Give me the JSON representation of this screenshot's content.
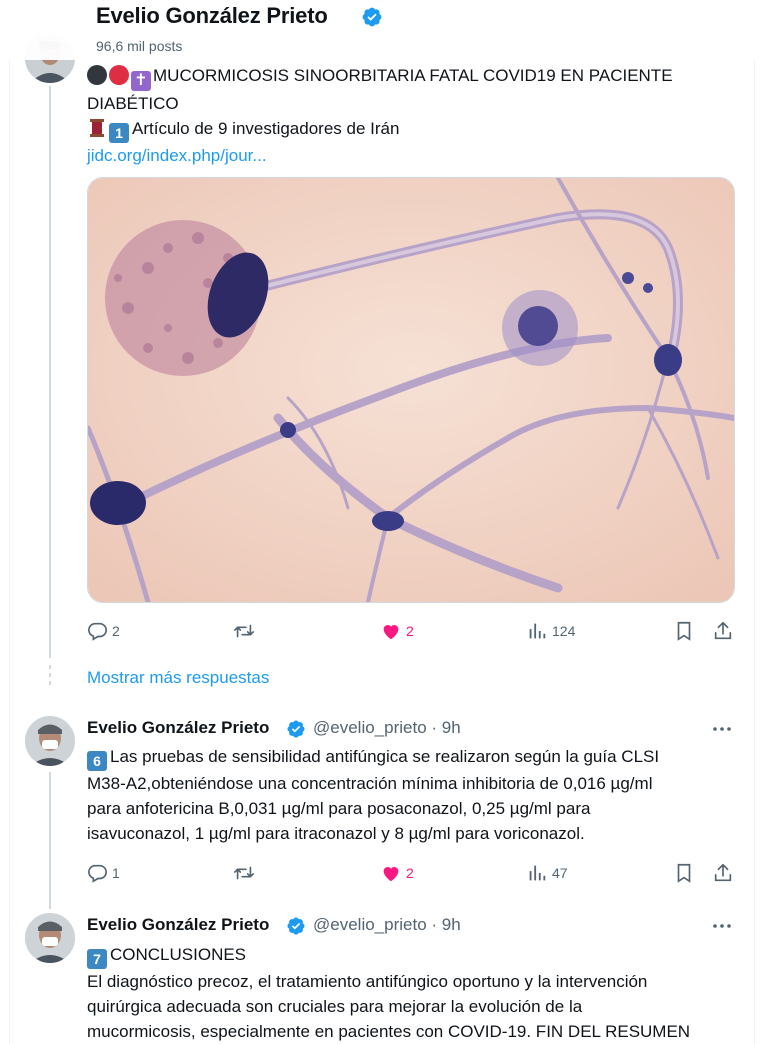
{
  "header": {
    "name": "Evelio González Prieto",
    "post_count": "96,6 mil posts"
  },
  "tweet1": {
    "line1": "MUCORMICOSIS SINOORBITARIA FATAL COVID19 EN PACIENTE",
    "line2": "DIABÉTICO",
    "line3": "Artículo de 9 investigadores de Irán",
    "line3_key": "1",
    "link": "jidc.org/index.php/jour...",
    "replies": "2",
    "likes": "2",
    "views": "124"
  },
  "show_more": "Mostrar más respuestas",
  "tweet2": {
    "name": "Evelio González Prieto",
    "handle": "@evelio_prieto",
    "dot": "·",
    "time": "9h",
    "key": "6",
    "line1": "Las pruebas de sensibilidad antifúngica se realizaron según la guía CLSI",
    "line2": "M38-A2,obteniéndose una concentración mínima inhibitoria de 0,016 µg/ml",
    "line3": "para anfotericina B,0,031 µg/ml para posaconazol, 0,25 µg/ml para",
    "line4": "isavuconazol, 1 µg/ml para itraconazol y 8 µg/ml para voriconazol.",
    "replies": "1",
    "likes": "2",
    "views": "47"
  },
  "tweet3": {
    "name": "Evelio González Prieto",
    "handle": "@evelio_prieto",
    "dot": "·",
    "time": "9h",
    "key": "7",
    "line1": "CONCLUSIONES",
    "line2": "El diagnóstico precoz, el tratamiento antifúngico oportuno y la intervención",
    "line3": "quirúrgica adecuada son cruciales para mejorar la evolución de la",
    "line4": "mucormicosis, especialmente en pacientes con COVID-19. FIN DEL RESUMEN"
  },
  "colors": {
    "accent": "#1d9bf0",
    "like": "#f91880",
    "muted": "#536471",
    "text": "#0f1419"
  },
  "icons": [
    "verified-icon",
    "reply-icon",
    "retweet-icon",
    "heart-icon",
    "views-icon",
    "bookmark-icon",
    "share-icon",
    "more-icon"
  ]
}
